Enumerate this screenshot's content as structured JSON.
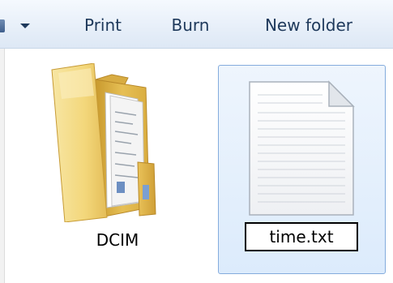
{
  "toolbar": {
    "dropdown_icon": "chevron-down-icon",
    "buttons": {
      "print": "Print",
      "burn": "Burn",
      "new_folder": "New folder"
    }
  },
  "files": {
    "dcim": {
      "name": "DCIM",
      "icon": "folder-icon"
    },
    "time": {
      "name": "time.txt",
      "icon": "text-document-icon",
      "selected": true,
      "renaming": true
    }
  },
  "colors": {
    "toolbar_text": "#1e395b",
    "selection_fill": "#dcebfc",
    "selection_border": "#84acdd",
    "folder_yellow": "#f3d77b"
  }
}
